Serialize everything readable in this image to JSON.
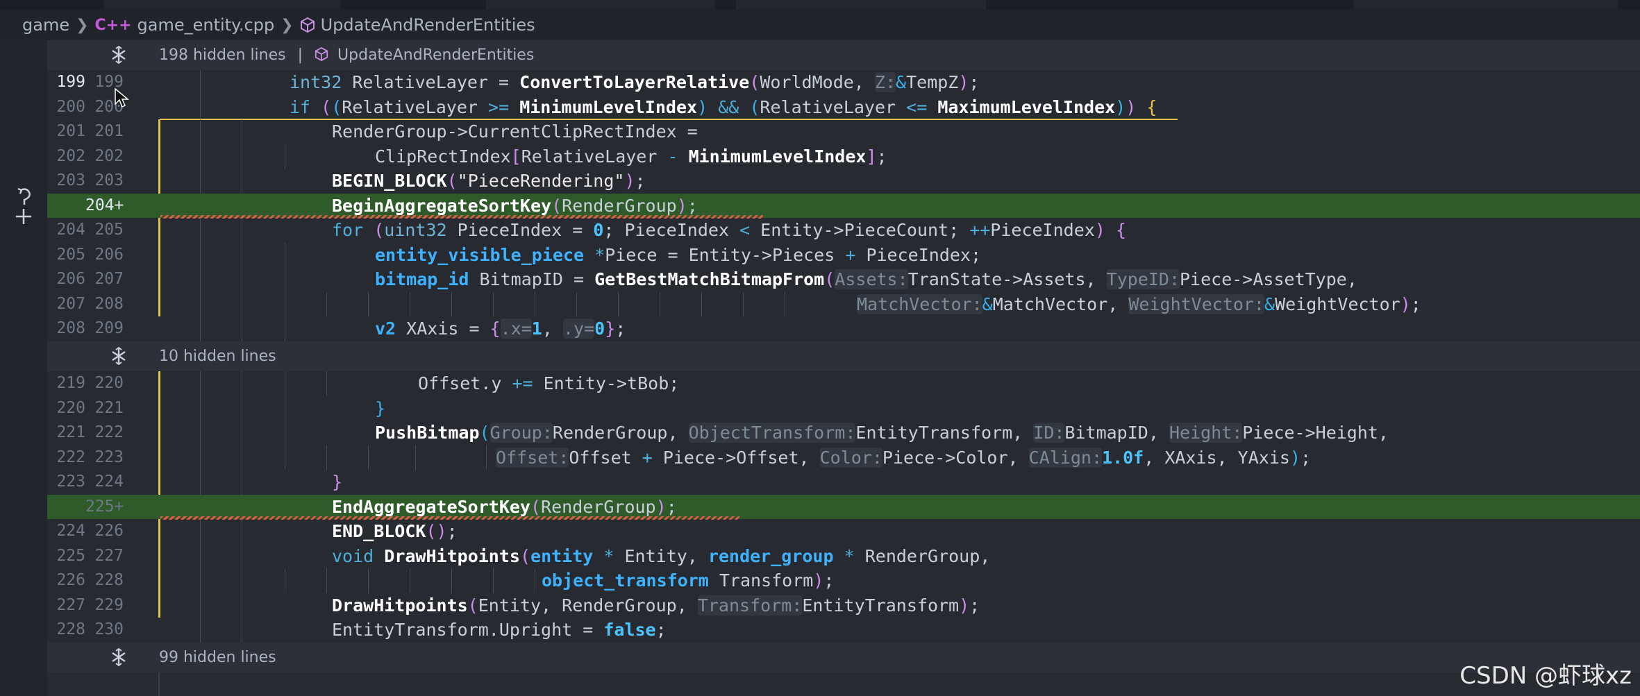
{
  "breadcrumb": {
    "items": [
      "game",
      "game_entity.cpp",
      "UpdateAndRenderEntities"
    ],
    "file_icon": "cpp-icon",
    "symbol_icon": "cube-icon"
  },
  "hidden_bands": [
    {
      "label": "198 hidden lines",
      "separator": "|",
      "symbol": "UpdateAndRenderEntities"
    },
    {
      "label": "10 hidden lines"
    },
    {
      "label": "99 hidden lines"
    }
  ],
  "lines_a": [
    {
      "old": "199",
      "new": "199"
    },
    {
      "old": "200",
      "new": "200"
    },
    {
      "old": "201",
      "new": "201"
    },
    {
      "old": "202",
      "new": "202"
    },
    {
      "old": "203",
      "new": "203"
    },
    {
      "old": "",
      "new": "204+"
    },
    {
      "old": "204",
      "new": "205"
    },
    {
      "old": "205",
      "new": "206"
    },
    {
      "old": "206",
      "new": "207"
    },
    {
      "old": "207",
      "new": "208"
    },
    {
      "old": "208",
      "new": "209"
    }
  ],
  "lines_b": [
    {
      "old": "219",
      "new": "220"
    },
    {
      "old": "220",
      "new": "221"
    },
    {
      "old": "221",
      "new": "222"
    },
    {
      "old": "222",
      "new": "223"
    },
    {
      "old": "223",
      "new": "224"
    },
    {
      "old": "",
      "new": "225+"
    },
    {
      "old": "224",
      "new": "226"
    },
    {
      "old": "225",
      "new": "227"
    },
    {
      "old": "226",
      "new": "228"
    },
    {
      "old": "227",
      "new": "229"
    },
    {
      "old": "228",
      "new": "230"
    }
  ],
  "watermark": "CSDN @虾球xz",
  "colors": {
    "background": "#272a31",
    "added_line": "#2f5a2a",
    "change_marker": "#e0c34b",
    "keyword": "#4eaed8",
    "error_squiggle": "#e05a46"
  }
}
